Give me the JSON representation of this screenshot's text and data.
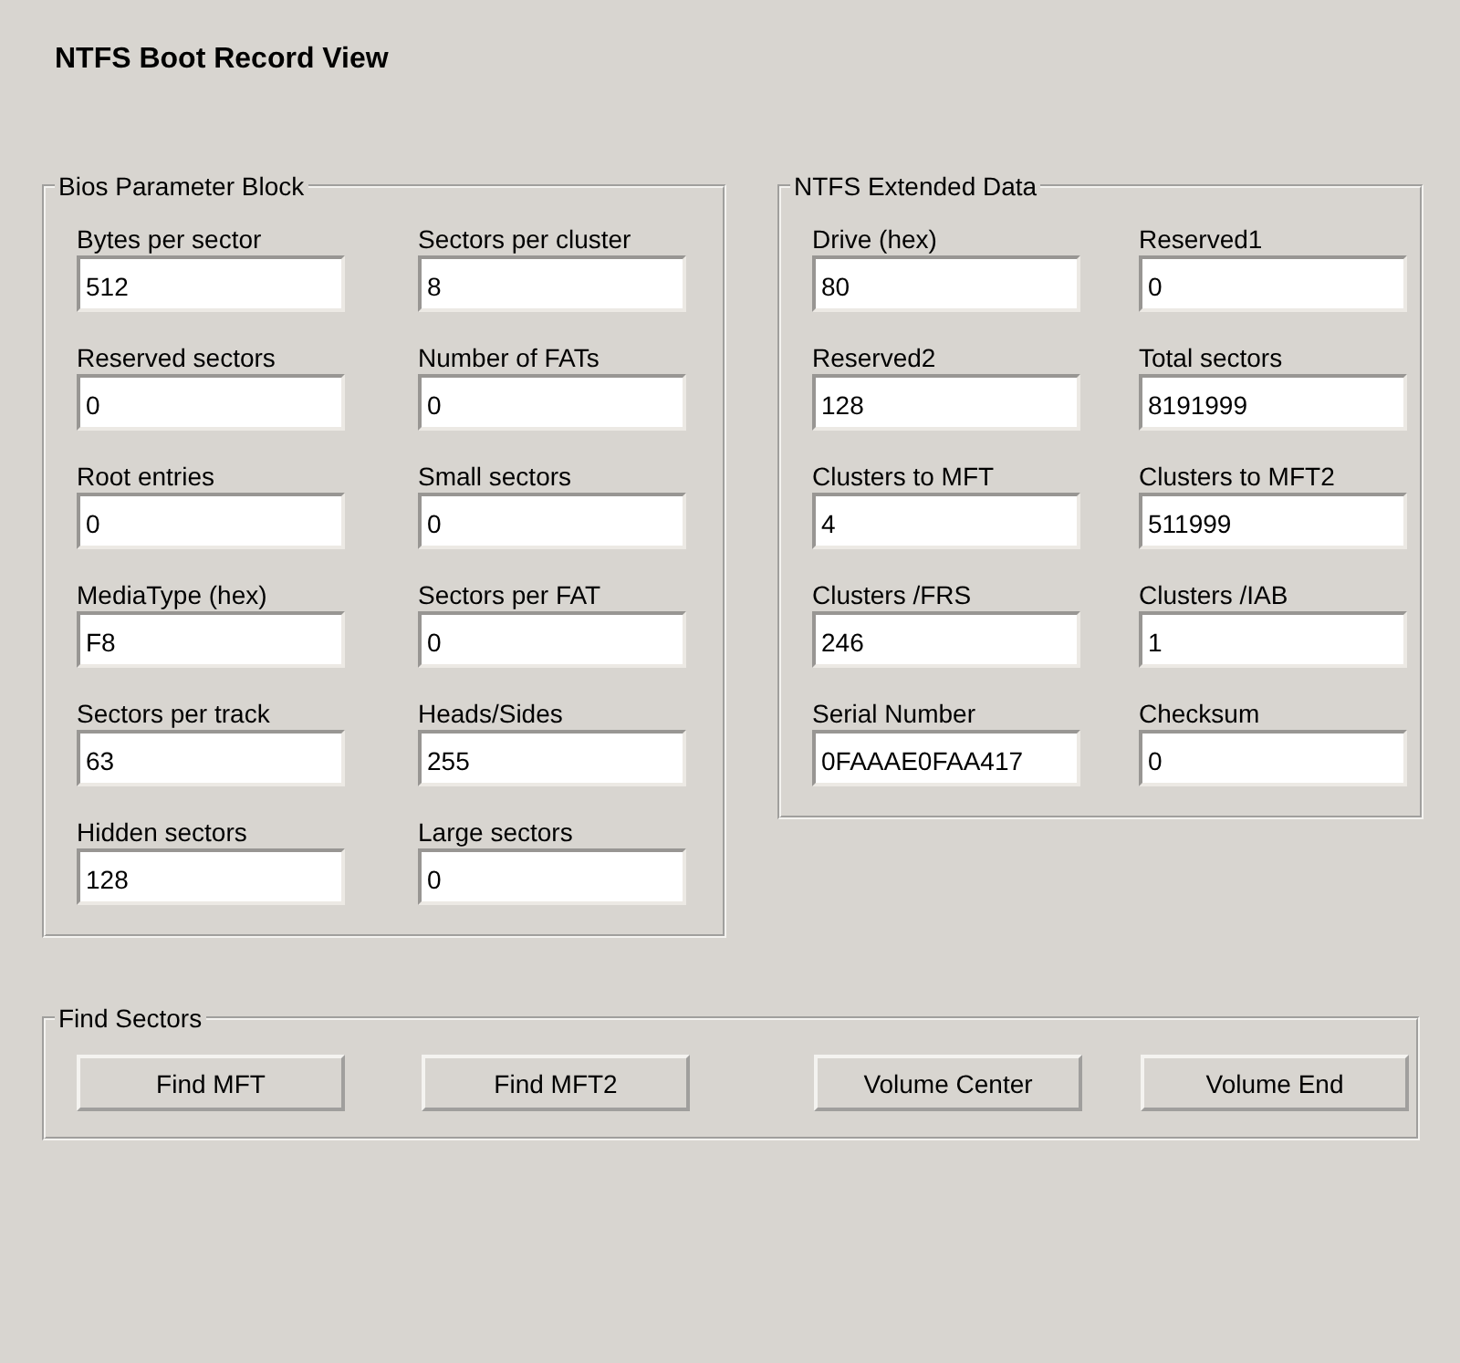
{
  "title": "NTFS Boot Record View",
  "groups": [
    {
      "title": "Bios Parameter Block",
      "fields": [
        {
          "label": "Bytes per sector",
          "value": "512"
        },
        {
          "label": "Sectors per cluster",
          "value": "8"
        },
        {
          "label": "Reserved sectors",
          "value": "0"
        },
        {
          "label": "Number of FATs",
          "value": "0"
        },
        {
          "label": "Root entries",
          "value": "0"
        },
        {
          "label": "Small sectors",
          "value": "0"
        },
        {
          "label": "MediaType (hex)",
          "value": "F8"
        },
        {
          "label": "Sectors per FAT",
          "value": "0"
        },
        {
          "label": "Sectors per track",
          "value": "63"
        },
        {
          "label": "Heads/Sides",
          "value": "255"
        },
        {
          "label": "Hidden sectors",
          "value": "128"
        },
        {
          "label": "Large sectors",
          "value": "0"
        }
      ]
    },
    {
      "title": "NTFS Extended Data",
      "fields": [
        {
          "label": "Drive (hex)",
          "value": "80"
        },
        {
          "label": "Reserved1",
          "value": "0"
        },
        {
          "label": "Reserved2",
          "value": "128"
        },
        {
          "label": "Total sectors",
          "value": "8191999"
        },
        {
          "label": "Clusters to MFT",
          "value": "4"
        },
        {
          "label": "Clusters to MFT2",
          "value": "511999"
        },
        {
          "label": "Clusters /FRS",
          "value": "246"
        },
        {
          "label": "Clusters /IAB",
          "value": "1"
        },
        {
          "label": "Serial Number",
          "value": "0FAAAE0FAA417"
        },
        {
          "label": "Checksum",
          "value": "0"
        }
      ]
    }
  ],
  "find_sectors": {
    "title": "Find Sectors",
    "buttons": [
      "Find MFT",
      "Find MFT2",
      "Volume Center",
      "Volume End"
    ]
  }
}
